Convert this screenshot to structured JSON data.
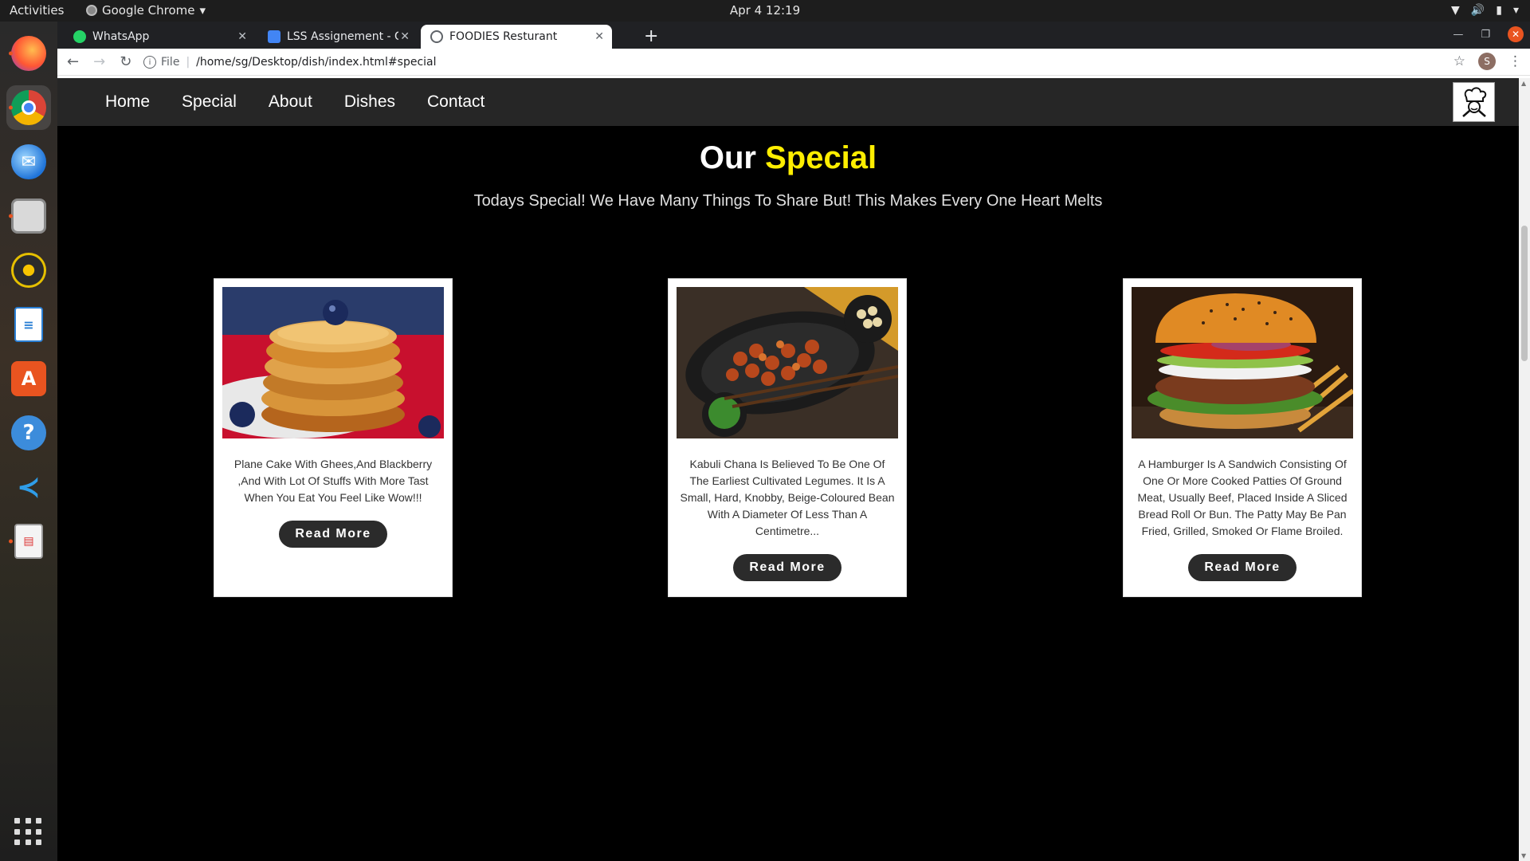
{
  "system": {
    "activities": "Activities",
    "app_menu": "Google Chrome",
    "clock": "Apr 4  12:19"
  },
  "dock": {
    "apps": [
      "firefox-icon",
      "chrome-icon",
      "thunderbird-icon",
      "files-icon",
      "rhythmbox-icon",
      "writer-icon",
      "software-icon",
      "help-icon",
      "vscode-icon",
      "document-viewer-icon"
    ]
  },
  "browser": {
    "tabs": [
      {
        "title": "WhatsApp",
        "favicon_color": "#25d366"
      },
      {
        "title": "LSS Assignement - Googl",
        "favicon_color": "#4285f4"
      },
      {
        "title": "FOODIES Resturant",
        "favicon_color": "#5f6368"
      }
    ],
    "url_scheme": "File",
    "url": "/home/sg/Desktop/dish/index.html#special",
    "profile_initial": "S"
  },
  "site": {
    "nav": [
      "Home",
      "Special",
      "About",
      "Dishes",
      "Contact"
    ],
    "heading_prefix": "Our",
    "heading_highlight": "Special",
    "accent_color": "#ffee00",
    "subheading": "Todays Special! We Have Many Things To Share But! This Makes Every One Heart Melts",
    "cards": [
      {
        "image": "pancakes-photo",
        "description": "Plane Cake With Ghees,And Blackberry ,And With Lot Of Stuffs With More Tast When You Eat You Feel Like Wow!!!",
        "button": "Read More"
      },
      {
        "image": "kabuli-chana-photo",
        "description": "Kabuli Chana Is Believed To Be One Of The Earliest Cultivated Legumes. It Is A Small, Hard, Knobby, Beige-Coloured Bean With A Diameter Of Less Than A Centimetre...",
        "button": "Read More"
      },
      {
        "image": "hamburger-photo",
        "description": "A Hamburger Is A Sandwich Consisting Of One Or More Cooked Patties Of Ground Meat, Usually Beef, Placed Inside A Sliced Bread Roll Or Bun. The Patty May Be Pan Fried, Grilled, Smoked Or Flame Broiled.",
        "button": "Read More"
      }
    ]
  }
}
